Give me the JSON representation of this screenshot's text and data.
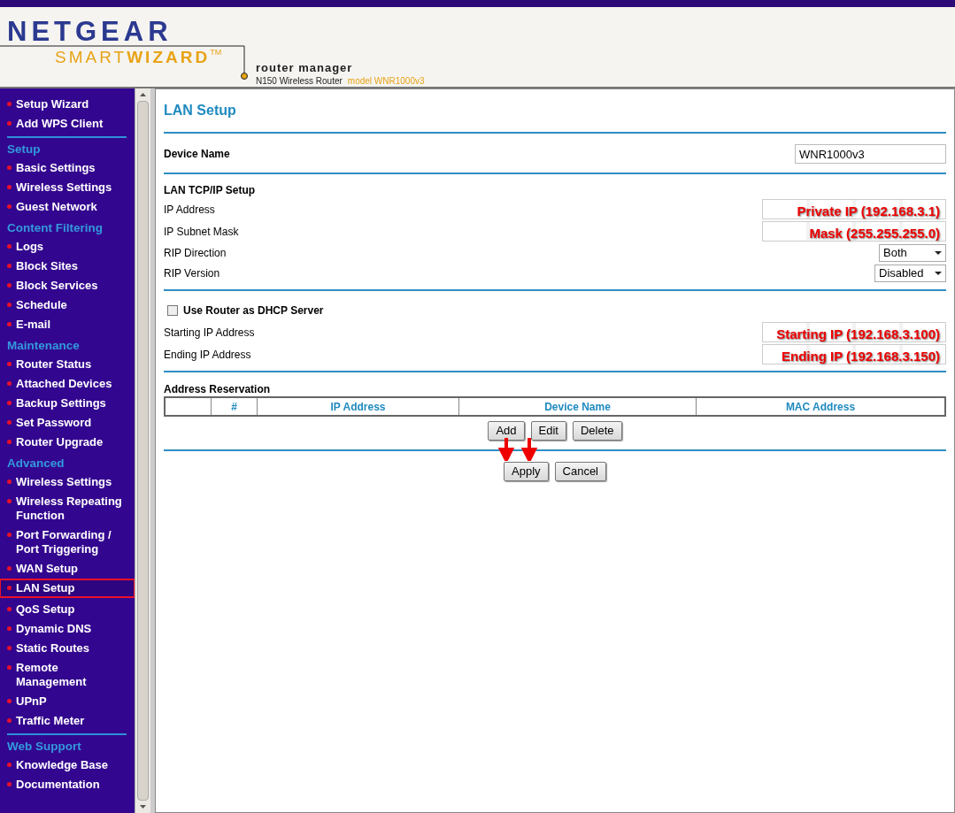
{
  "header": {
    "brand": "NETGEAR",
    "product_light": "SMART",
    "product_bold": "WIZARD",
    "trademark": "TM",
    "subtitle": "router manager",
    "device": "N150 Wireless Router",
    "model": "model WNR1000v3"
  },
  "sidebar": {
    "items": [
      {
        "kind": "link",
        "label": "Setup Wizard",
        "selected": false
      },
      {
        "kind": "link",
        "label": "Add WPS Client",
        "selected": false
      },
      {
        "kind": "heading",
        "label": "Setup",
        "separated": true
      },
      {
        "kind": "link",
        "label": "Basic Settings",
        "selected": false
      },
      {
        "kind": "link",
        "label": "Wireless Settings",
        "selected": false
      },
      {
        "kind": "link",
        "label": "Guest Network",
        "selected": false
      },
      {
        "kind": "heading",
        "label": "Content Filtering",
        "separated": false
      },
      {
        "kind": "link",
        "label": "Logs",
        "selected": false
      },
      {
        "kind": "link",
        "label": "Block Sites",
        "selected": false
      },
      {
        "kind": "link",
        "label": "Block Services",
        "selected": false
      },
      {
        "kind": "link",
        "label": "Schedule",
        "selected": false
      },
      {
        "kind": "link",
        "label": "E-mail",
        "selected": false
      },
      {
        "kind": "heading",
        "label": "Maintenance",
        "separated": false
      },
      {
        "kind": "link",
        "label": "Router Status",
        "selected": false
      },
      {
        "kind": "link",
        "label": "Attached Devices",
        "selected": false
      },
      {
        "kind": "link",
        "label": "Backup Settings",
        "selected": false
      },
      {
        "kind": "link",
        "label": "Set Password",
        "selected": false
      },
      {
        "kind": "link",
        "label": "Router Upgrade",
        "selected": false
      },
      {
        "kind": "heading",
        "label": "Advanced",
        "separated": false
      },
      {
        "kind": "link",
        "label": "Wireless Settings",
        "selected": false
      },
      {
        "kind": "link",
        "label": "Wireless Repeating Function",
        "selected": false
      },
      {
        "kind": "link",
        "label": "Port Forwarding / Port Triggering",
        "selected": false
      },
      {
        "kind": "link",
        "label": "WAN Setup",
        "selected": false
      },
      {
        "kind": "link",
        "label": "LAN Setup",
        "selected": true
      },
      {
        "kind": "link",
        "label": "QoS Setup",
        "selected": false
      },
      {
        "kind": "link",
        "label": "Dynamic DNS",
        "selected": false
      },
      {
        "kind": "link",
        "label": "Static Routes",
        "selected": false
      },
      {
        "kind": "link",
        "label": "Remote Management",
        "selected": false
      },
      {
        "kind": "link",
        "label": "UPnP",
        "selected": false
      },
      {
        "kind": "link",
        "label": "Traffic Meter",
        "selected": false
      },
      {
        "kind": "heading",
        "label": "Web Support",
        "separated": true
      },
      {
        "kind": "link",
        "label": "Knowledge Base",
        "selected": false
      },
      {
        "kind": "link",
        "label": "Documentation",
        "selected": false
      }
    ]
  },
  "page": {
    "title": "LAN Setup",
    "device_name": {
      "label": "Device Name",
      "value": "WNR1000v3"
    },
    "tcpip": {
      "heading": "LAN TCP/IP Setup",
      "ip_label": "IP Address",
      "ip_note": "Private IP (192.168.3.1)",
      "mask_label": "IP Subnet Mask",
      "mask_note": "Mask (255.255.255.0)",
      "rip_direction_label": "RIP Direction",
      "rip_direction": "Both",
      "rip_version_label": "RIP Version",
      "rip_version": "Disabled"
    },
    "dhcp": {
      "label": "Use Router as DHCP Server",
      "checked": false,
      "start_label": "Starting IP Address",
      "start_note": "Starting IP (192.168.3.100)",
      "end_label": "Ending IP Address",
      "end_note": "Ending IP (192.168.3.150)"
    },
    "reservation": {
      "heading": "Address Reservation",
      "columns": [
        "#",
        "IP Address",
        "Device Name",
        "MAC Address"
      ],
      "buttons": [
        "Add",
        "Edit",
        "Delete"
      ]
    },
    "buttons": [
      "Apply",
      "Cancel"
    ]
  }
}
